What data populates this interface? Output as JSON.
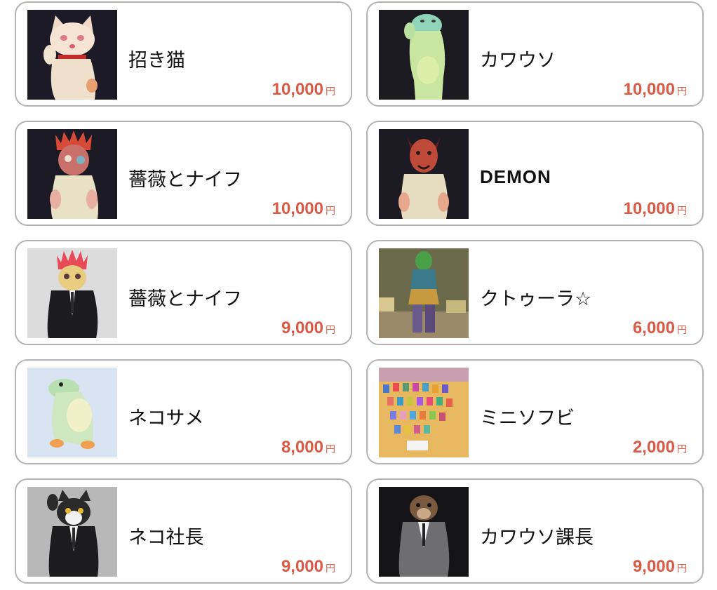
{
  "products": [
    {
      "name": "招き猫",
      "price": "10,000",
      "currency": "円",
      "image_icon": "maneki-neko-figure-photo"
    },
    {
      "name": "カワウソ",
      "price": "10,000",
      "currency": "円",
      "image_icon": "otter-figure-photo"
    },
    {
      "name": "薔薇とナイフ",
      "price": "10,000",
      "currency": "円",
      "image_icon": "rose-head-figure-photo"
    },
    {
      "name": "DEMON",
      "price": "10,000",
      "currency": "円",
      "image_icon": "demon-figure-photo"
    },
    {
      "name": "薔薇とナイフ",
      "price": "9,000",
      "currency": "円",
      "image_icon": "rose-head-suit-figure-photo"
    },
    {
      "name": "クトゥーラ☆",
      "price": "6,000",
      "currency": "円",
      "image_icon": "cthulhu-figure-photo"
    },
    {
      "name": "ネコサメ",
      "price": "8,000",
      "currency": "円",
      "image_icon": "neko-shark-figure-photo"
    },
    {
      "name": "ミニソフビ",
      "price": "2,000",
      "currency": "円",
      "image_icon": "mini-sofubi-collection-photo"
    },
    {
      "name": "ネコ社長",
      "price": "9,000",
      "currency": "円",
      "image_icon": "cat-boss-figure-photo"
    },
    {
      "name": "カワウソ課長",
      "price": "9,000",
      "currency": "円",
      "image_icon": "otter-manager-figure-photo"
    }
  ],
  "colors": {
    "price": "#d95a45",
    "card_border": "#b3b3b3"
  }
}
